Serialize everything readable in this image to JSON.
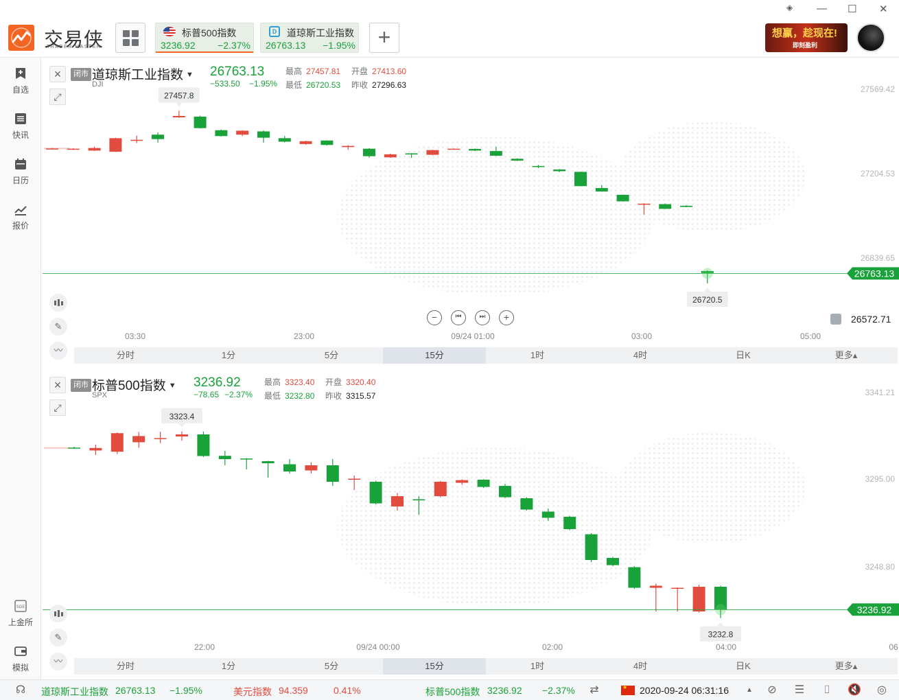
{
  "app": {
    "logo_text": "交易侠",
    "logo_sub": "TRADER MASTER"
  },
  "tabs": [
    {
      "name": "标普500指数",
      "price": "3236.92",
      "pct": "−2.37%"
    },
    {
      "name": "道琼斯工业指数",
      "price": "26763.13",
      "pct": "−1.95%"
    }
  ],
  "add_tab_label": "+",
  "ad": {
    "title": "想赢，趁现在!",
    "sub": "即刻盈利"
  },
  "window_controls": [
    "◈",
    "—",
    "☐",
    "✕"
  ],
  "sidebar": {
    "top_items": [
      {
        "label": "自选",
        "icon": "bookmark-plus-icon"
      },
      {
        "label": "快讯",
        "icon": "news-list-icon"
      },
      {
        "label": "日历",
        "icon": "calendar-icon"
      },
      {
        "label": "报价",
        "icon": "quote-chart-icon"
      }
    ],
    "bottom_items": [
      {
        "label": "上金所",
        "icon": "sge-icon"
      },
      {
        "label": "模拟",
        "icon": "wallet-icon"
      }
    ]
  },
  "panels": [
    {
      "badge": "闭市",
      "name": "道琼斯工业指数",
      "code": "DJI",
      "price": "26763.13",
      "change": "−533.50",
      "change_pct": "−1.95%",
      "high_label": "最高",
      "high": "27457.81",
      "open_label": "开盘",
      "open": "27413.60",
      "low_label": "最低",
      "low": "26720.53",
      "prev_label": "昨收",
      "prev": "27296.63",
      "alarm_value": "26572.71",
      "chart_data": {
        "type": "candlestick",
        "y_ticks": [
          "27569.42",
          "27204.53",
          "26839.65"
        ],
        "ylim": [
          26550,
          27650
        ],
        "x_ticks": [
          "03:30",
          "23:00",
          "09/24 01:00",
          "03:00",
          "05:00"
        ],
        "last_price_label": "26763.13",
        "max_label": "27457.8",
        "min_label": "26720.5",
        "candles": [
          {
            "o": 27296,
            "c": 27297,
            "h": 27299,
            "l": 27294
          },
          {
            "o": 27293,
            "c": 27296,
            "h": 27298,
            "l": 27291
          },
          {
            "o": 27288,
            "c": 27299,
            "h": 27305,
            "l": 27286
          },
          {
            "o": 27283,
            "c": 27341,
            "h": 27343,
            "l": 27282
          },
          {
            "o": 27331,
            "c": 27334,
            "h": 27352,
            "l": 27320
          },
          {
            "o": 27356,
            "c": 27337,
            "h": 27366,
            "l": 27322
          },
          {
            "o": 27430,
            "c": 27436,
            "h": 27458,
            "l": 27428
          },
          {
            "o": 27433,
            "c": 27384,
            "h": 27437,
            "l": 27383
          },
          {
            "o": 27375,
            "c": 27350,
            "h": 27378,
            "l": 27348
          },
          {
            "o": 27356,
            "c": 27373,
            "h": 27375,
            "l": 27350
          },
          {
            "o": 27370,
            "c": 27343,
            "h": 27374,
            "l": 27322
          },
          {
            "o": 27341,
            "c": 27326,
            "h": 27350,
            "l": 27323
          },
          {
            "o": 27316,
            "c": 27328,
            "h": 27330,
            "l": 27313
          },
          {
            "o": 27331,
            "c": 27312,
            "h": 27332,
            "l": 27310
          },
          {
            "o": 27303,
            "c": 27308,
            "h": 27311,
            "l": 27291
          },
          {
            "o": 27296,
            "c": 27264,
            "h": 27298,
            "l": 27258
          },
          {
            "o": 27259,
            "c": 27272,
            "h": 27275,
            "l": 27257
          },
          {
            "o": 27276,
            "c": 27275,
            "h": 27277,
            "l": 27257
          },
          {
            "o": 27270,
            "c": 27290,
            "h": 27292,
            "l": 27268
          },
          {
            "o": 27295,
            "c": 27296,
            "h": 27297,
            "l": 27294
          },
          {
            "o": 27295,
            "c": 27288,
            "h": 27297,
            "l": 27286
          },
          {
            "o": 27286,
            "c": 27266,
            "h": 27304,
            "l": 27264
          },
          {
            "o": 27253,
            "c": 27245,
            "h": 27255,
            "l": 27243
          },
          {
            "o": 27222,
            "c": 27221,
            "h": 27227,
            "l": 27213
          },
          {
            "o": 27207,
            "c": 27200,
            "h": 27209,
            "l": 27196
          },
          {
            "o": 27197,
            "c": 27136,
            "h": 27198,
            "l": 27135
          },
          {
            "o": 27128,
            "c": 27113,
            "h": 27141,
            "l": 27112
          },
          {
            "o": 27099,
            "c": 27071,
            "h": 27100,
            "l": 27070
          },
          {
            "o": 27057,
            "c": 27061,
            "h": 27063,
            "l": 27014
          },
          {
            "o": 27059,
            "c": 27039,
            "h": 27062,
            "l": 27038
          },
          {
            "o": 27052,
            "c": 27047,
            "h": 27055,
            "l": 27046
          },
          {
            "o": 26773,
            "c": 26763,
            "h": 26776,
            "l": 26720
          }
        ]
      }
    },
    {
      "badge": "闭市",
      "name": "标普500指数",
      "code": "SPX",
      "price": "3236.92",
      "change": "−78.65",
      "change_pct": "−2.37%",
      "high_label": "最高",
      "high": "3323.40",
      "open_label": "开盘",
      "open": "3320.40",
      "low_label": "最低",
      "low": "3232.80",
      "prev_label": "昨收",
      "prev": "3315.57",
      "alarm_value": "",
      "chart_data": {
        "type": "candlestick",
        "y_ticks": [
          "3341.21",
          "3295.00",
          "3248.80"
        ],
        "ylim": [
          3225,
          3350
        ],
        "x_ticks": [
          "22:00",
          "09/24 00:00",
          "02:00",
          "04:00",
          "06"
        ],
        "last_price_label": "3236.92",
        "max_label": "3323.4",
        "min_label": "3232.8",
        "candles": [
          {
            "o": 3315.6,
            "c": 3315.4,
            "h": 3316.0,
            "l": 3315.0
          },
          {
            "o": 3314.2,
            "c": 3315.4,
            "h": 3317.0,
            "l": 3312.0
          },
          {
            "o": 3313.6,
            "c": 3322.6,
            "h": 3323.0,
            "l": 3312.5
          },
          {
            "o": 3318.2,
            "c": 3321.2,
            "h": 3323.2,
            "l": 3315.5
          },
          {
            "o": 3320.0,
            "c": 3320.2,
            "h": 3323.3,
            "l": 3317.8
          },
          {
            "o": 3321.0,
            "c": 3322.0,
            "h": 3323.4,
            "l": 3319.0
          },
          {
            "o": 3322.0,
            "c": 3311.5,
            "h": 3323.4,
            "l": 3311.0
          },
          {
            "o": 3311.6,
            "c": 3310.0,
            "h": 3314.0,
            "l": 3307.0
          },
          {
            "o": 3310.3,
            "c": 3310.0,
            "h": 3310.5,
            "l": 3305.0
          },
          {
            "o": 3309.0,
            "c": 3308.0,
            "h": 3309.2,
            "l": 3301.0
          },
          {
            "o": 3307.5,
            "c": 3304.0,
            "h": 3310.0,
            "l": 3303.0
          },
          {
            "o": 3304.5,
            "c": 3307.0,
            "h": 3308.5,
            "l": 3303.0
          },
          {
            "o": 3307.0,
            "c": 3299.0,
            "h": 3310.0,
            "l": 3297.0
          },
          {
            "o": 3300.0,
            "c": 3300.5,
            "h": 3302.0,
            "l": 3295.0
          },
          {
            "o": 3299.0,
            "c": 3288.5,
            "h": 3299.5,
            "l": 3288.0
          },
          {
            "o": 3287.0,
            "c": 3292.0,
            "h": 3293.5,
            "l": 3285.0
          },
          {
            "o": 3290.5,
            "c": 3290.0,
            "h": 3292.0,
            "l": 3283.0
          },
          {
            "o": 3292.0,
            "c": 3299.0,
            "h": 3299.4,
            "l": 3291.5
          },
          {
            "o": 3298.5,
            "c": 3299.8,
            "h": 3300.2,
            "l": 3297.5
          },
          {
            "o": 3300.0,
            "c": 3296.5,
            "h": 3300.2,
            "l": 3296.0
          },
          {
            "o": 3297.0,
            "c": 3291.5,
            "h": 3298.0,
            "l": 3291.0
          },
          {
            "o": 3291.0,
            "c": 3285.5,
            "h": 3291.5,
            "l": 3285.0
          },
          {
            "o": 3284.5,
            "c": 3281.5,
            "h": 3286.0,
            "l": 3280.0
          },
          {
            "o": 3282.0,
            "c": 3276.0,
            "h": 3282.5,
            "l": 3275.5
          },
          {
            "o": 3273.5,
            "c": 3261.0,
            "h": 3274.0,
            "l": 3260.0
          },
          {
            "o": 3262.0,
            "c": 3258.5,
            "h": 3262.5,
            "l": 3258.0
          },
          {
            "o": 3257.5,
            "c": 3247.5,
            "h": 3258.0,
            "l": 3247.0
          },
          {
            "o": 3247.5,
            "c": 3248.5,
            "h": 3249.5,
            "l": 3236.0
          },
          {
            "o": 3247.0,
            "c": 3247.5,
            "h": 3247.7,
            "l": 3236.0
          },
          {
            "o": 3236.0,
            "c": 3248.0,
            "h": 3249.0,
            "l": 3235.5
          },
          {
            "o": 3248.0,
            "c": 3236.9,
            "h": 3248.5,
            "l": 3232.8
          }
        ]
      }
    }
  ],
  "controls": {
    "zoom_out": "−",
    "step_back": "⏮",
    "step_fwd": "⏭",
    "zoom_in": "+"
  },
  "periods": [
    "分时",
    "1分",
    "5分",
    "15分",
    "1时",
    "4时",
    "日K",
    "更多▴"
  ],
  "selected_period": "15分",
  "statusbar": {
    "item1_name": "道琼斯工业指数",
    "item1_price": "26763.13",
    "item1_pct": "−1.95%",
    "item2_name": "美元指数",
    "item2_price": "94.359",
    "item2_pct": "0.41%",
    "item3_name": "标普500指数",
    "item3_price": "3236.92",
    "item3_pct": "−2.37%",
    "datetime": "2020-09-24 06:31:16"
  },
  "colors": {
    "up": "#e24c3f",
    "down": "#1aa23a",
    "accent": "#f26522"
  }
}
